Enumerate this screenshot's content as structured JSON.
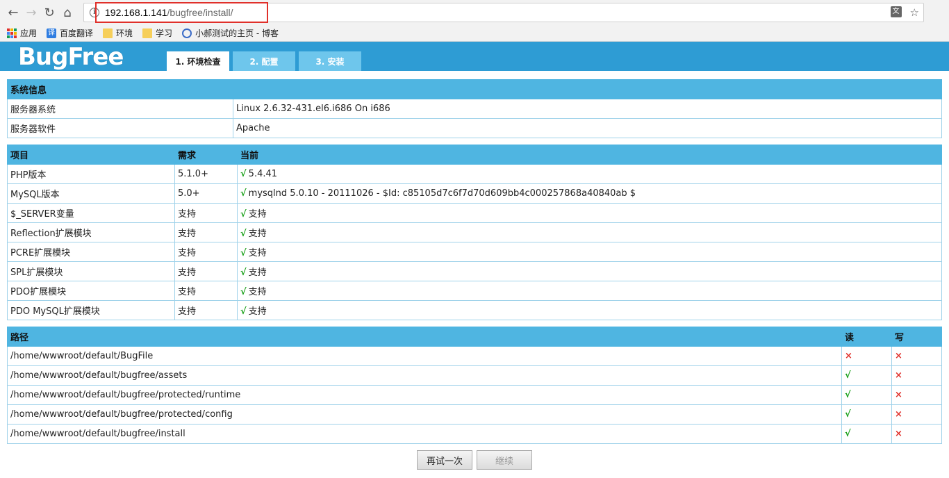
{
  "browser": {
    "url_host": "192.168.1.141",
    "url_path": "/bugfree/install/",
    "bookmarks": [
      {
        "label": "应用",
        "icon": "apps-icon"
      },
      {
        "label": "百度翻译",
        "icon": "yi-icon"
      },
      {
        "label": "环境",
        "icon": "folder-icon"
      },
      {
        "label": "学习",
        "icon": "folder-icon"
      },
      {
        "label": "小郝测试的主页 - 博客",
        "icon": "blog-icon"
      }
    ],
    "yi_glyph": "译"
  },
  "header": {
    "logo": "BugFree",
    "tabs": [
      {
        "label": "1. 环境检查",
        "active": true
      },
      {
        "label": "2. 配置",
        "active": false
      },
      {
        "label": "3. 安装",
        "active": false
      }
    ]
  },
  "system_info": {
    "header": "系统信息",
    "rows": [
      {
        "label": "服务器系统",
        "value": "Linux 2.6.32-431.el6.i686 On i686"
      },
      {
        "label": "服务器软件",
        "value": "Apache"
      }
    ]
  },
  "requirements": {
    "headers": [
      "项目",
      "需求",
      "当前"
    ],
    "check": "√",
    "rows": [
      {
        "item": "PHP版本",
        "need": "5.1.0+",
        "current": "5.4.41"
      },
      {
        "item": "MySQL版本",
        "need": "5.0+",
        "current": "mysqlnd 5.0.10 - 20111026 - $Id: c85105d7c6f7d70d609bb4c000257868a40840ab $"
      },
      {
        "item": "$_SERVER变量",
        "need": "支持",
        "current": "支持"
      },
      {
        "item": "Reflection扩展模块",
        "need": "支持",
        "current": "支持"
      },
      {
        "item": "PCRE扩展模块",
        "need": "支持",
        "current": "支持"
      },
      {
        "item": "SPL扩展模块",
        "need": "支持",
        "current": "支持"
      },
      {
        "item": "PDO扩展模块",
        "need": "支持",
        "current": "支持"
      },
      {
        "item": "PDO MySQL扩展模块",
        "need": "支持",
        "current": "支持"
      }
    ]
  },
  "paths": {
    "headers": [
      "路径",
      "读",
      "写"
    ],
    "rows": [
      {
        "path": "/home/wwwroot/default/BugFile",
        "read": "×",
        "write": "×"
      },
      {
        "path": "/home/wwwroot/default/bugfree/assets",
        "read": "√",
        "write": "×"
      },
      {
        "path": "/home/wwwroot/default/bugfree/protected/runtime",
        "read": "√",
        "write": "×"
      },
      {
        "path": "/home/wwwroot/default/bugfree/protected/config",
        "read": "√",
        "write": "×"
      },
      {
        "path": "/home/wwwroot/default/bugfree/install",
        "read": "√",
        "write": "×"
      }
    ]
  },
  "actions": {
    "retry": "再试一次",
    "continue": "继续"
  },
  "colors": {
    "header_bg": "#2e9cd4",
    "table_header": "#4fb5e1",
    "ok": "#18a018",
    "bad": "#e0302a"
  }
}
